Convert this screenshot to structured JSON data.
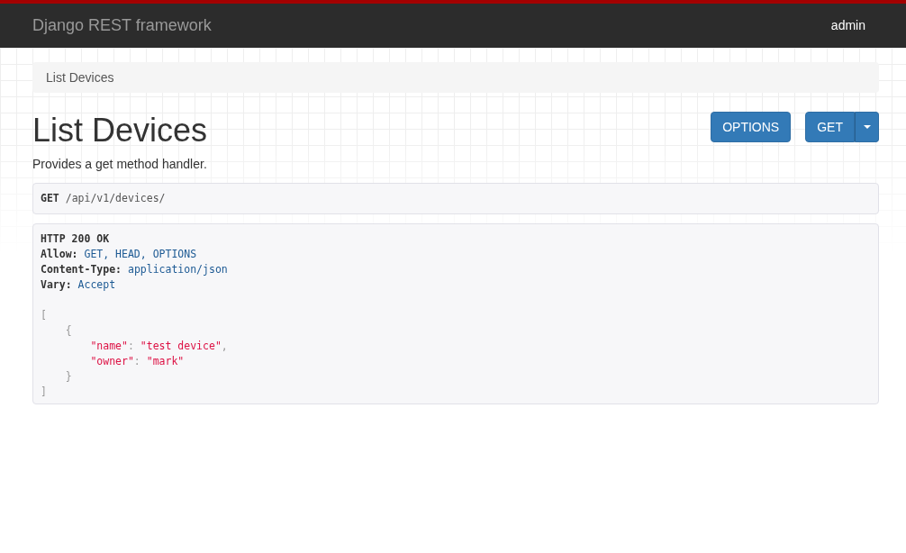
{
  "navbar": {
    "brand": "Django REST framework",
    "user": "admin"
  },
  "breadcrumb": [
    {
      "label": "List Devices",
      "selected": true
    }
  ],
  "page": {
    "title": "List Devices",
    "description": "Provides a get method handler.",
    "buttons": [
      {
        "label": "OPTIONS",
        "kind": "plain"
      },
      {
        "label": "GET",
        "kind": "split"
      }
    ]
  },
  "request": {
    "method": "GET",
    "url": "/api/v1/devices/"
  },
  "response": {
    "status": "HTTP 200 OK",
    "headers": [
      {
        "name": "Allow:",
        "value": "GET, HEAD, OPTIONS"
      },
      {
        "name": "Content-Type:",
        "value": "application/json"
      },
      {
        "name": "Vary:",
        "value": "Accept"
      }
    ],
    "body": [
      [
        {
          "kind": "punct",
          "text": "["
        }
      ],
      [
        {
          "kind": "punct",
          "text": "    {"
        }
      ],
      [
        {
          "kind": "string",
          "text": "        \"name\""
        },
        {
          "kind": "punct",
          "text": ": "
        },
        {
          "kind": "string",
          "text": "\"test device\""
        },
        {
          "kind": "punct",
          "text": ","
        }
      ],
      [
        {
          "kind": "string",
          "text": "        \"owner\""
        },
        {
          "kind": "punct",
          "text": ": "
        },
        {
          "kind": "string",
          "text": "\"mark\""
        }
      ],
      [
        {
          "kind": "punct",
          "text": "    }"
        }
      ],
      [
        {
          "kind": "punct",
          "text": "]"
        }
      ]
    ]
  }
}
